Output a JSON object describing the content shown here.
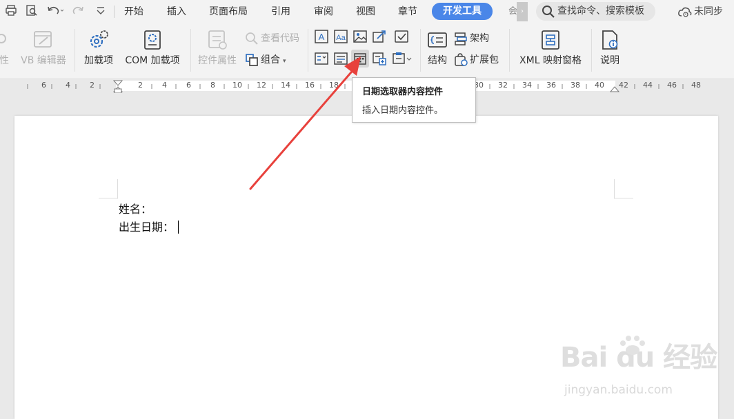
{
  "menu": {
    "tabs": [
      "开始",
      "插入",
      "页面布局",
      "引用",
      "审阅",
      "视图",
      "章节",
      "开发工具"
    ],
    "active_tab": "开发工具",
    "overflow_glyph": "会",
    "search_placeholder": "查找命令、搜索模板",
    "sync_label": "未同步"
  },
  "ribbon": {
    "macro_partial_label": "性",
    "vb_editor": "VB 编辑器",
    "addins": "加载项",
    "com_addins": "COM 加载项",
    "control_properties": "控件属性",
    "view_code": "查看代码",
    "group": "组合",
    "structure": "结构",
    "schema": "架构",
    "expansion_pack": "扩展包",
    "xml_mapping": "XML 映射窗格",
    "help": "说明"
  },
  "ruler": {
    "labels": [
      "6",
      "4",
      "2",
      "2",
      "4",
      "6",
      "8",
      "10",
      "12",
      "14",
      "16",
      "18",
      "30",
      "32",
      "34",
      "36",
      "38",
      "40",
      "42",
      "44",
      "46",
      "48"
    ]
  },
  "tooltip": {
    "title": "日期选取器内容控件",
    "description": "插入日期内容控件。"
  },
  "document": {
    "line1": "姓名：",
    "line2": "出生日期："
  },
  "watermark": {
    "logo": "Bai du 经验",
    "url": "jingyan.baidu.com"
  },
  "colors": {
    "accent": "#4a86e8",
    "arrow": "#e8413c",
    "icon_blue": "#2f6fc0"
  }
}
